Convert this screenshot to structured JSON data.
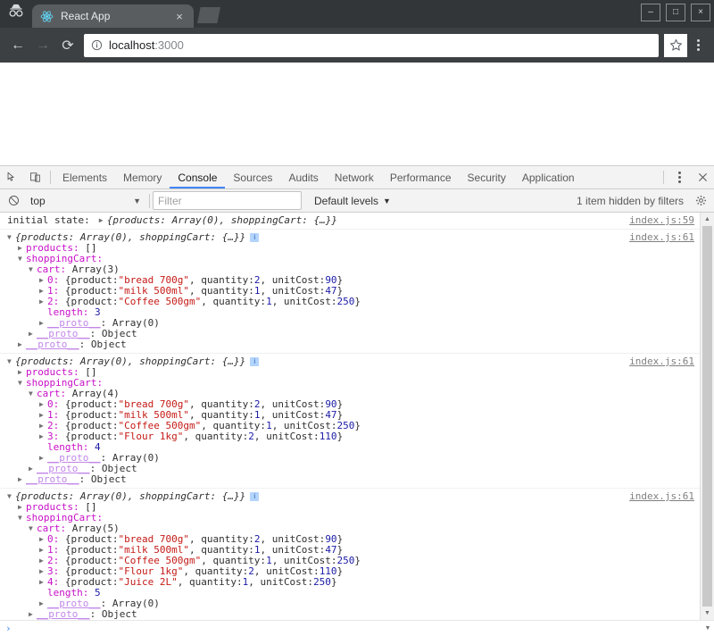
{
  "window": {
    "minimize_label": "–",
    "maximize_label": "□",
    "close_label": "×"
  },
  "browser": {
    "incognito_icon": "incognito-icon",
    "tab": {
      "title": "React App",
      "favicon": "react-logo-icon",
      "close_label": "×"
    },
    "nav": {
      "back_label": "←",
      "forward_label": "→",
      "reload_label": "⟳"
    },
    "omnibox": {
      "host": "localhost",
      "port": ":3000",
      "info_icon": "page-info-icon"
    },
    "bookmark_icon": "star-icon",
    "menu_icon": "three-dot-menu-icon"
  },
  "devtools": {
    "inspect_icon": "inspect-element-icon",
    "device_icon": "device-toolbar-icon",
    "tabs": [
      {
        "label": "Elements",
        "active": false
      },
      {
        "label": "Memory",
        "active": false
      },
      {
        "label": "Console",
        "active": true
      },
      {
        "label": "Sources",
        "active": false
      },
      {
        "label": "Audits",
        "active": false
      },
      {
        "label": "Network",
        "active": false
      },
      {
        "label": "Performance",
        "active": false
      },
      {
        "label": "Security",
        "active": false
      },
      {
        "label": "Application",
        "active": false
      }
    ],
    "more_icon": "more-tools-icon",
    "close_icon": "close-devtools-icon",
    "toolbar": {
      "clear_icon": "clear-console-icon",
      "context": "top",
      "context_caret": "▼",
      "filter_placeholder": "Filter",
      "filter_value": "",
      "levels": "Default levels",
      "levels_caret": "▼",
      "hidden_message": "1 item hidden by filters",
      "settings_icon": "gear-icon"
    },
    "prompt": {
      "chevron": "›",
      "value": ""
    }
  },
  "console": {
    "messages": [
      {
        "source": "index.js:59",
        "label": "initial state:",
        "preview": "{products: Array(0), shoppingCart: {…}}",
        "collapsed": true
      },
      {
        "source": "index.js:61",
        "preview": "{products: Array(0), shoppingCart: {…}}",
        "info_badge": "i",
        "products_key": "products:",
        "products_value": "[]",
        "shoppingcart_key": "shoppingCart:",
        "cart_key": "cart:",
        "cart_type": "Array(3)",
        "items": [
          {
            "index": "0:",
            "product": "\"bread 700g\"",
            "quantity": "2",
            "unitCost": "90"
          },
          {
            "index": "1:",
            "product": "\"milk 500ml\"",
            "quantity": "1",
            "unitCost": "47"
          },
          {
            "index": "2:",
            "product": "\"Coffee 500gm\"",
            "quantity": "1",
            "unitCost": "250"
          }
        ],
        "length_key": "length:",
        "length_value": "3",
        "proto_key": "__proto__",
        "proto_array": "Array(0)",
        "proto_object": "Object"
      },
      {
        "source": "index.js:61",
        "preview": "{products: Array(0), shoppingCart: {…}}",
        "info_badge": "i",
        "products_key": "products:",
        "products_value": "[]",
        "shoppingcart_key": "shoppingCart:",
        "cart_key": "cart:",
        "cart_type": "Array(4)",
        "items": [
          {
            "index": "0:",
            "product": "\"bread 700g\"",
            "quantity": "2",
            "unitCost": "90"
          },
          {
            "index": "1:",
            "product": "\"milk 500ml\"",
            "quantity": "1",
            "unitCost": "47"
          },
          {
            "index": "2:",
            "product": "\"Coffee 500gm\"",
            "quantity": "1",
            "unitCost": "250"
          },
          {
            "index": "3:",
            "product": "\"Flour 1kg\"",
            "quantity": "2",
            "unitCost": "110"
          }
        ],
        "length_key": "length:",
        "length_value": "4",
        "proto_key": "__proto__",
        "proto_array": "Array(0)",
        "proto_object": "Object"
      },
      {
        "source": "index.js:61",
        "preview": "{products: Array(0), shoppingCart: {…}}",
        "info_badge": "i",
        "products_key": "products:",
        "products_value": "[]",
        "shoppingcart_key": "shoppingCart:",
        "cart_key": "cart:",
        "cart_type": "Array(5)",
        "items": [
          {
            "index": "0:",
            "product": "\"bread 700g\"",
            "quantity": "2",
            "unitCost": "90"
          },
          {
            "index": "1:",
            "product": "\"milk 500ml\"",
            "quantity": "1",
            "unitCost": "47"
          },
          {
            "index": "2:",
            "product": "\"Coffee 500gm\"",
            "quantity": "1",
            "unitCost": "250"
          },
          {
            "index": "3:",
            "product": "\"Flour 1kg\"",
            "quantity": "2",
            "unitCost": "110"
          },
          {
            "index": "4:",
            "product": "\"Juice 2L\"",
            "quantity": "1",
            "unitCost": "250"
          }
        ],
        "length_key": "length:",
        "length_value": "5",
        "proto_key": "__proto__",
        "proto_array": "Array(0)",
        "proto_object": "Object"
      }
    ],
    "labels": {
      "quantity_key": ", quantity: ",
      "unitcost_key": ", unitCost: ",
      "product_key": "{product: ",
      "brace_close": "}"
    }
  }
}
